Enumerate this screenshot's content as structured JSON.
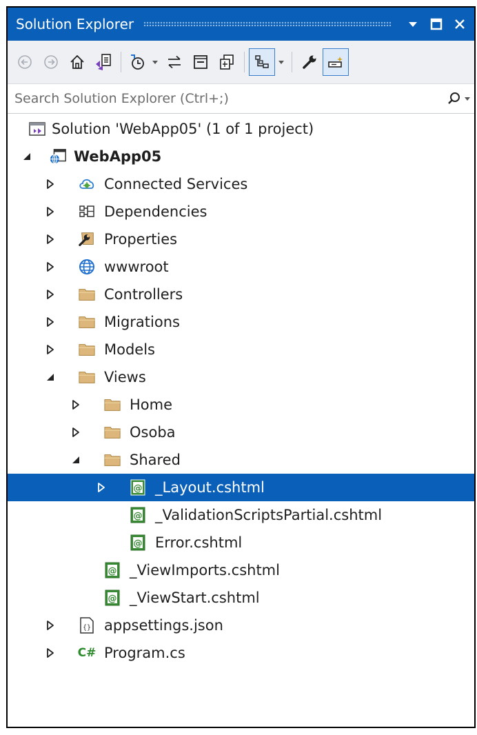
{
  "window": {
    "title": "Solution Explorer"
  },
  "search": {
    "placeholder": "Search Solution Explorer (Ctrl+;)"
  },
  "tree": [
    {
      "label": "Solution 'WebApp05' (1 of 1 project)",
      "icon": "solution-icon",
      "level": 0,
      "expander": "none"
    },
    {
      "label": "WebApp05",
      "icon": "web-project-icon",
      "level": 0,
      "expander": "expanded",
      "bold": true
    },
    {
      "label": "Connected Services",
      "icon": "connected-services-icon",
      "level": 1,
      "expander": "collapsed"
    },
    {
      "label": "Dependencies",
      "icon": "dependencies-icon",
      "level": 1,
      "expander": "collapsed"
    },
    {
      "label": "Properties",
      "icon": "properties-icon",
      "level": 1,
      "expander": "collapsed"
    },
    {
      "label": "wwwroot",
      "icon": "globe-icon",
      "level": 1,
      "expander": "collapsed"
    },
    {
      "label": "Controllers",
      "icon": "folder-icon",
      "level": 1,
      "expander": "collapsed"
    },
    {
      "label": "Migrations",
      "icon": "folder-icon",
      "level": 1,
      "expander": "collapsed"
    },
    {
      "label": "Models",
      "icon": "folder-icon",
      "level": 1,
      "expander": "collapsed"
    },
    {
      "label": "Views",
      "icon": "folder-icon",
      "level": 1,
      "expander": "expanded"
    },
    {
      "label": "Home",
      "icon": "folder-icon",
      "level": 2,
      "expander": "collapsed"
    },
    {
      "label": "Osoba",
      "icon": "folder-icon",
      "level": 2,
      "expander": "collapsed"
    },
    {
      "label": "Shared",
      "icon": "folder-icon",
      "level": 2,
      "expander": "expanded"
    },
    {
      "label": "_Layout.cshtml",
      "icon": "razor-file-icon",
      "level": 3,
      "expander": "collapsed",
      "selected": true
    },
    {
      "label": "_ValidationScriptsPartial.cshtml",
      "icon": "razor-file-icon",
      "level": 3,
      "expander": "none"
    },
    {
      "label": "Error.cshtml",
      "icon": "razor-file-icon",
      "level": 3,
      "expander": "none"
    },
    {
      "label": "_ViewImports.cshtml",
      "icon": "razor-file-icon",
      "level": 2,
      "expander": "none"
    },
    {
      "label": "_ViewStart.cshtml",
      "icon": "razor-file-icon",
      "level": 2,
      "expander": "none"
    },
    {
      "label": "appsettings.json",
      "icon": "json-file-icon",
      "level": 1,
      "expander": "collapsed"
    },
    {
      "label": "Program.cs",
      "icon": "csharp-file-icon",
      "level": 1,
      "expander": "collapsed",
      "icon_text": "C#"
    }
  ],
  "colors": {
    "accent": "#0a60b8",
    "folder": "#dcb67a",
    "razor": "#388a34"
  }
}
